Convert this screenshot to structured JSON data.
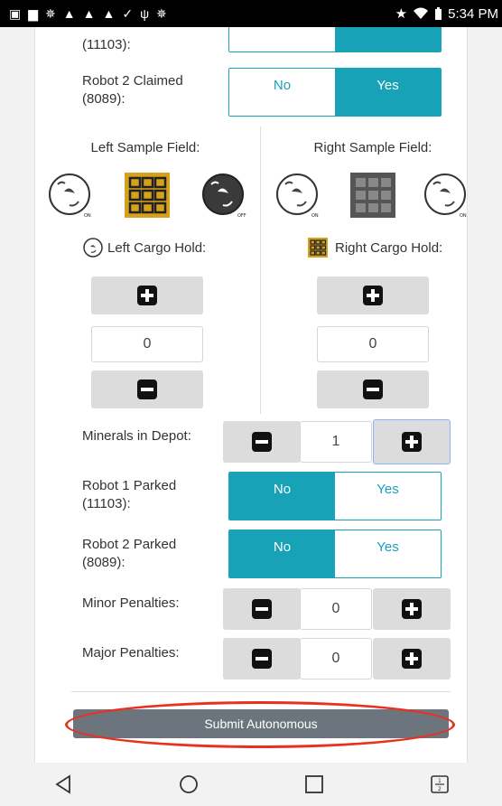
{
  "status_bar": {
    "time": "5:34 PM"
  },
  "fields": {
    "robot1_claimed_label": "(11103):",
    "robot2_claimed_label_line1": "Robot 2 Claimed",
    "robot2_claimed_label_line2": "(8089):",
    "no": "No",
    "yes": "Yes",
    "left_sample_field": "Left Sample Field:",
    "right_sample_field": "Right Sample Field:",
    "left_cargo_hold": "Left Cargo Hold:",
    "right_cargo_hold": "Right Cargo Hold:",
    "left_cargo_value": "0",
    "right_cargo_value": "0",
    "minerals_in_depot": "Minerals in Depot:",
    "minerals_value": "1",
    "robot1_parked_line1": "Robot 1 Parked",
    "robot1_parked_line2": "(11103):",
    "robot2_parked_line1": "Robot 2 Parked",
    "robot2_parked_line2": "(8089):",
    "minor_penalties": "Minor Penalties:",
    "minor_value": "0",
    "major_penalties": "Major Penalties:",
    "major_value": "0",
    "mineral_on": "ON",
    "mineral_off": "OFF"
  },
  "submit_label": "Submit Autonomous",
  "colors": {
    "accent": "#17a2b8",
    "gold": "#d4a11d",
    "submit": "#6c757d",
    "annotation": "#e8321f"
  },
  "icons": [
    "back-icon",
    "home-icon",
    "recents-icon",
    "split-screen-icon",
    "plus-icon",
    "minus-icon",
    "silver-mineral-icon",
    "gold-mineral-icon",
    "wifi-icon",
    "star-icon",
    "battery-icon"
  ]
}
